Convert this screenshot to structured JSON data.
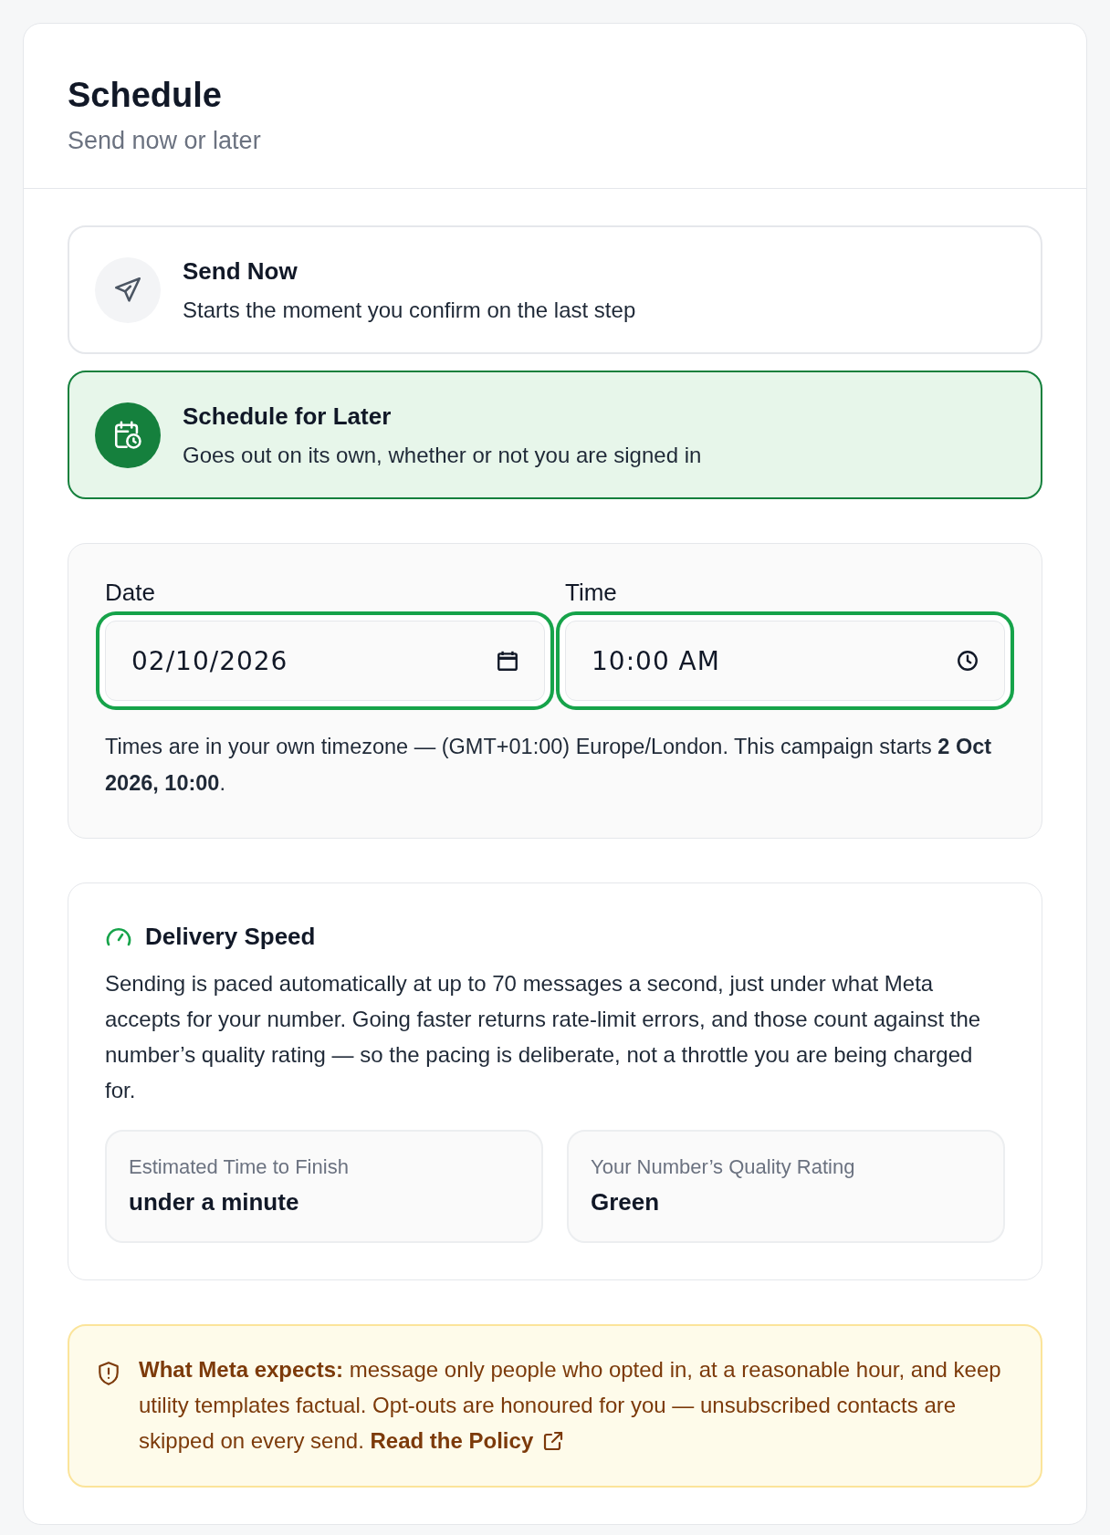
{
  "header": {
    "title": "Schedule",
    "subtitle": "Send now or later"
  },
  "options": [
    {
      "kind": "now",
      "title": "Send Now",
      "description": "Starts the moment you confirm on the last step",
      "selected": false
    },
    {
      "kind": "later",
      "title": "Schedule for Later",
      "description": "Goes out on its own, whether or not you are signed in",
      "selected": true
    }
  ],
  "schedule": {
    "fields": [
      {
        "kind": "date",
        "label": "Date",
        "value": "02/10/2026"
      },
      {
        "kind": "time",
        "label": "Time",
        "value": "10:00 AM"
      }
    ],
    "note": "Times are in your own timezone — (GMT+01:00) Europe/London. This campaign starts **2 Oct 2026, 10:00**."
  },
  "delivery": {
    "title": "Delivery Speed",
    "body": "Sending is paced automatically at up to 70 messages a second, just under what Meta accepts for your number. Going faster returns rate-limit errors, and those count against the number’s quality rating — so the pacing is deliberate, not a throttle you are being charged for.",
    "stats": [
      {
        "label": "Estimated Time to Finish",
        "value": "under a minute"
      },
      {
        "label": "Your Number’s Quality Rating",
        "value": "Green"
      }
    ]
  },
  "notice": {
    "text": "**What Meta expects:** message only people who opted in, at a reasonable hour, and keep utility templates factual. Opt-outs are honoured for you — unsubscribed contacts are skipped on every send.",
    "link": "Read the Policy"
  }
}
